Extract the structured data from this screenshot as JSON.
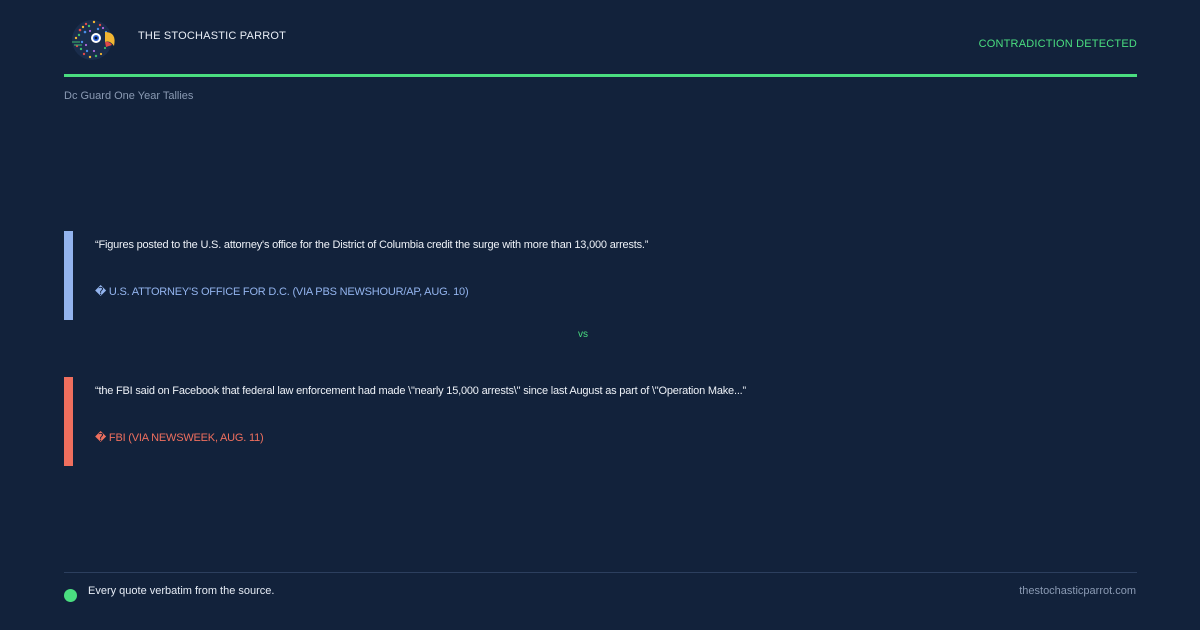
{
  "header": {
    "brand": "THE STOCHASTIC PARROT",
    "status": "CONTRADICTION DETECTED",
    "logo_icon": "parrot-logo-icon"
  },
  "topic": "Dc Guard One Year Tallies",
  "quotes": [
    {
      "text": "“Figures posted to the U.S. attorney's office for the District of Columbia credit the surge with more than 13,000 arrests.”",
      "source": "� U.S. ATTORNEY'S OFFICE FOR D.C. (VIA PBS NEWSHOUR/AP, AUG. 10)",
      "accent": "#93b4ee"
    },
    {
      "text": "“the FBI said on Facebook that federal law enforcement had made \\\"nearly 15,000 arrests\\\" since last August as part of \\\"Operation Make...”",
      "source": "� FBI (VIA NEWSWEEK, AUG. 11)",
      "accent": "#ef6f5e"
    }
  ],
  "vs_label": "vs",
  "footer": {
    "note": "Every quote verbatim from the source.",
    "site": "thestochasticparrot.com"
  },
  "colors": {
    "background": "#12223b",
    "accent_green": "#4ade80",
    "muted": "#8a9ab3"
  }
}
